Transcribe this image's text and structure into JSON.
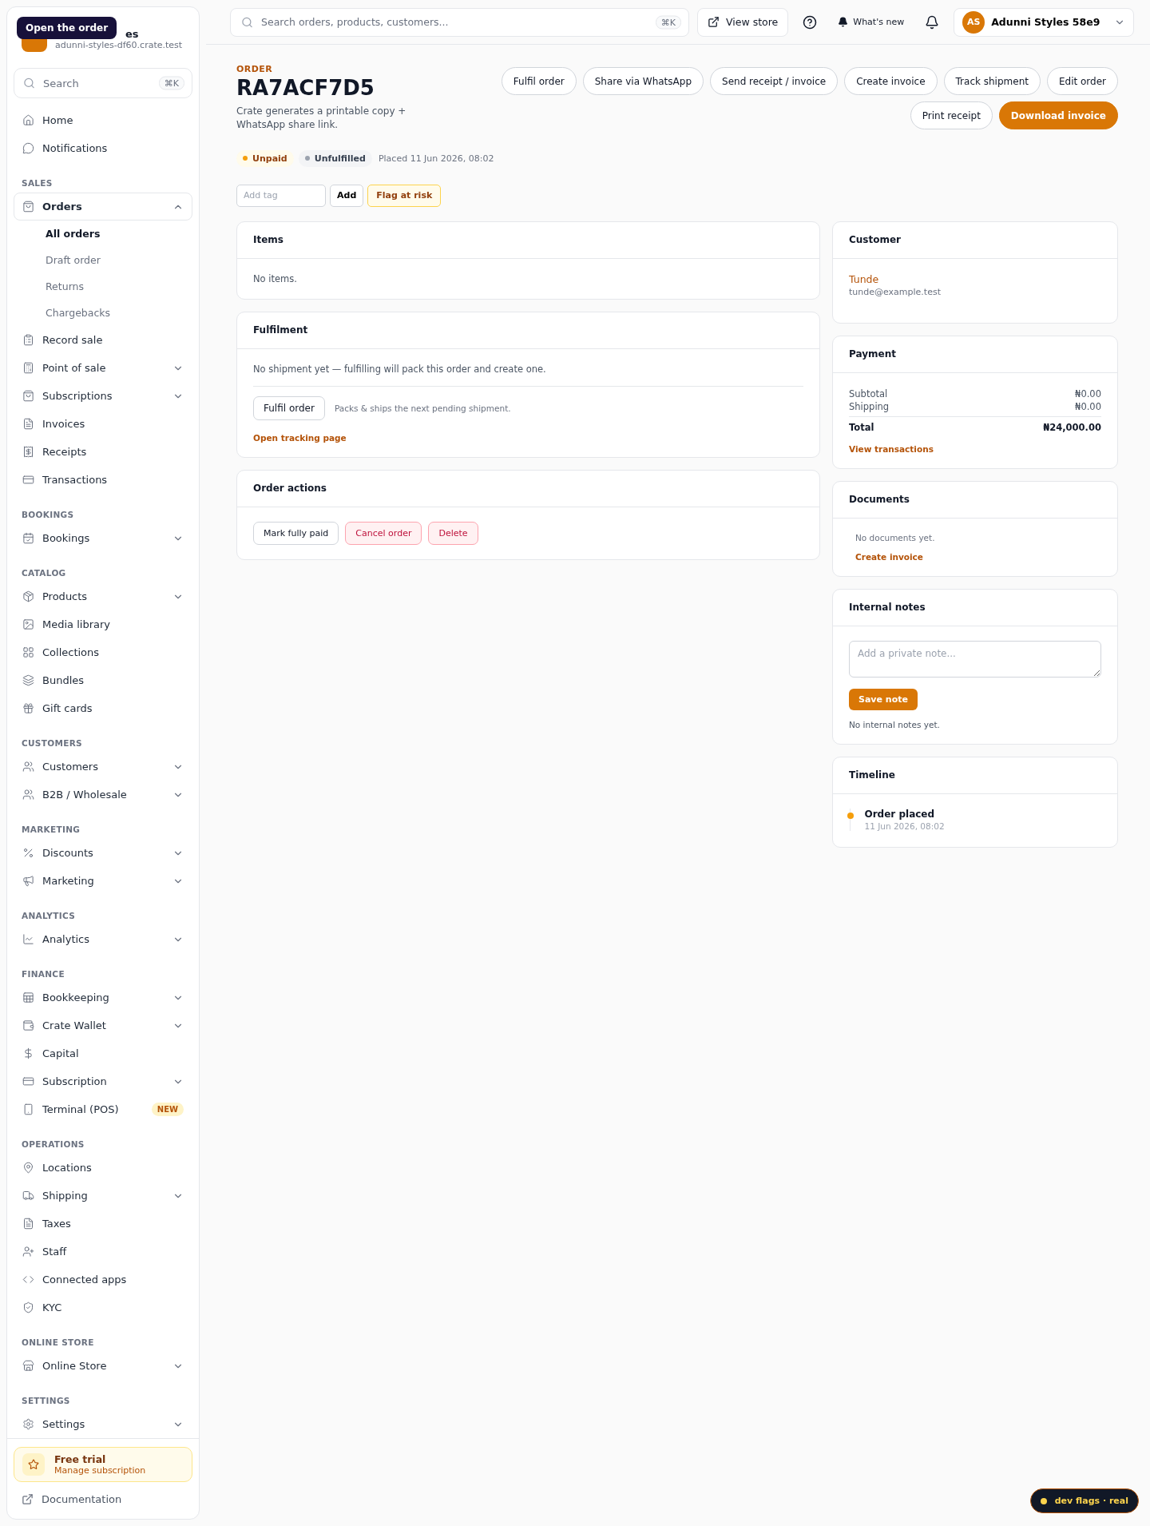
{
  "tooltip": "Open the order",
  "store": {
    "name": "es",
    "domain": "adunni-styles-df60.crate.test"
  },
  "sidebar_search": {
    "placeholder": "Search",
    "shortcut": "⌘K"
  },
  "sidebar": [
    {
      "items": [
        {
          "label": "Home",
          "kind": "link",
          "selected": false
        },
        {
          "label": "Notifications",
          "kind": "link",
          "selected": false
        }
      ]
    },
    {
      "title": "SALES",
      "items": [
        {
          "label": "Orders",
          "kind": "group",
          "expanded": true,
          "selected": true,
          "children": [
            {
              "label": "All orders",
              "selected": true
            },
            {
              "label": "Draft order",
              "selected": false
            },
            {
              "label": "Returns",
              "selected": false
            },
            {
              "label": "Chargebacks",
              "selected": false
            }
          ]
        },
        {
          "label": "Record sale",
          "kind": "link",
          "selected": false
        },
        {
          "label": "Point of sale",
          "kind": "group",
          "expanded": false,
          "selected": false
        },
        {
          "label": "Subscriptions",
          "kind": "group",
          "expanded": false,
          "selected": false
        },
        {
          "label": "Invoices",
          "kind": "link",
          "selected": false
        },
        {
          "label": "Receipts",
          "kind": "link",
          "selected": false
        },
        {
          "label": "Transactions",
          "kind": "link",
          "selected": false
        }
      ]
    },
    {
      "title": "BOOKINGS",
      "items": [
        {
          "label": "Bookings",
          "kind": "group",
          "expanded": false,
          "selected": false
        }
      ]
    },
    {
      "title": "CATALOG",
      "items": [
        {
          "label": "Products",
          "kind": "group",
          "expanded": false,
          "selected": false
        },
        {
          "label": "Media library",
          "kind": "link",
          "selected": false
        },
        {
          "label": "Collections",
          "kind": "link",
          "selected": false
        },
        {
          "label": "Bundles",
          "kind": "link",
          "selected": false
        },
        {
          "label": "Gift cards",
          "kind": "link",
          "selected": false
        }
      ]
    },
    {
      "title": "CUSTOMERS",
      "items": [
        {
          "label": "Customers",
          "kind": "group",
          "expanded": false,
          "selected": false
        },
        {
          "label": "B2B / Wholesale",
          "kind": "group",
          "expanded": false,
          "selected": false
        }
      ]
    },
    {
      "title": "MARKETING",
      "items": [
        {
          "label": "Discounts",
          "kind": "group",
          "expanded": false,
          "selected": false
        },
        {
          "label": "Marketing",
          "kind": "group",
          "expanded": false,
          "selected": false
        }
      ]
    },
    {
      "title": "ANALYTICS",
      "items": [
        {
          "label": "Analytics",
          "kind": "group",
          "expanded": false,
          "selected": false
        }
      ]
    },
    {
      "title": "FINANCE",
      "items": [
        {
          "label": "Bookkeeping",
          "kind": "group",
          "expanded": false,
          "selected": false
        },
        {
          "label": "Crate Wallet",
          "kind": "group",
          "expanded": false,
          "selected": false
        },
        {
          "label": "Capital",
          "kind": "link",
          "selected": false
        },
        {
          "label": "Subscription",
          "kind": "group",
          "expanded": false,
          "selected": false
        },
        {
          "label": "Terminal (POS)",
          "kind": "link",
          "selected": false,
          "badge": "NEW"
        }
      ]
    },
    {
      "title": "OPERATIONS",
      "items": [
        {
          "label": "Locations",
          "kind": "link",
          "selected": false
        },
        {
          "label": "Shipping",
          "kind": "group",
          "expanded": false,
          "selected": false
        },
        {
          "label": "Taxes",
          "kind": "link",
          "selected": false
        },
        {
          "label": "Staff",
          "kind": "link",
          "selected": false
        },
        {
          "label": "Connected apps",
          "kind": "link",
          "selected": false
        },
        {
          "label": "KYC",
          "kind": "link",
          "selected": false
        }
      ]
    },
    {
      "title": "ONLINE STORE",
      "items": [
        {
          "label": "Online Store",
          "kind": "group",
          "expanded": false,
          "selected": false
        }
      ]
    },
    {
      "title": "SETTINGS",
      "items": [
        {
          "label": "Settings",
          "kind": "group",
          "expanded": false,
          "selected": false
        }
      ]
    }
  ],
  "trial": {
    "title": "Free trial",
    "link": "Manage subscription"
  },
  "documentation": "Documentation",
  "topbar": {
    "search": {
      "placeholder": "Search orders, products, customers...",
      "shortcut": "⌘K"
    },
    "view_store": "View store",
    "whats_new": "What's new",
    "account": {
      "initials": "AS",
      "name": "Adunni Styles 58e9"
    }
  },
  "order": {
    "eyebrow": "ORDER",
    "id": "RA7ACF7D5",
    "description": "Crate generates a printable copy + WhatsApp share link.",
    "actions": [
      [
        {
          "label": "Fulfil order",
          "primary": false
        },
        {
          "label": "Share via WhatsApp",
          "primary": false
        },
        {
          "label": "Send receipt / invoice",
          "primary": false
        },
        {
          "label": "Create invoice",
          "primary": false
        },
        {
          "label": "Track shipment",
          "primary": false
        },
        {
          "label": "Edit order",
          "primary": false
        }
      ],
      [
        {
          "label": "Print receipt",
          "primary": false
        },
        {
          "label": "Download invoice",
          "primary": true
        }
      ]
    ],
    "statuses": [
      {
        "label": "Unpaid",
        "color": "#f59e0b"
      },
      {
        "label": "Unfulfilled",
        "color": "#9ca3af"
      }
    ],
    "placed": "Placed 11 Jun 2026, 08:02",
    "tag_input": {
      "placeholder": "Add tag"
    },
    "add_tag": "Add",
    "flag": "Flag at risk"
  },
  "items_card": {
    "title": "Items",
    "empty": "No items."
  },
  "fulfilment": {
    "title": "Fulfilment",
    "message": "No shipment yet — fulfilling will pack this order and create one.",
    "button": "Fulfil order",
    "hint": "Packs & ships the next pending shipment.",
    "link": "Open tracking page"
  },
  "order_actions": {
    "title": "Order actions",
    "buttons": [
      {
        "label": "Mark fully paid",
        "kind": "neutral"
      },
      {
        "label": "Cancel order",
        "kind": "danger"
      },
      {
        "label": "Delete",
        "kind": "danger"
      }
    ]
  },
  "customer": {
    "title": "Customer",
    "name": "Tunde",
    "email": "tunde@example.test"
  },
  "payment": {
    "title": "Payment",
    "rows": [
      {
        "label": "Subtotal",
        "value": "₦0.00",
        "kind": "line"
      },
      {
        "label": "Shipping",
        "value": "₦0.00",
        "kind": "line"
      },
      {
        "label": "Total",
        "value": "₦24,000.00",
        "kind": "total"
      }
    ],
    "link": "View transactions"
  },
  "documents": {
    "title": "Documents",
    "empty": "No documents yet.",
    "link": "Create invoice"
  },
  "notes": {
    "title": "Internal notes",
    "placeholder": "Add a private note...",
    "button": "Save note",
    "empty": "No internal notes yet."
  },
  "timeline": {
    "title": "Timeline",
    "events": [
      {
        "title": "Order placed",
        "time": "11 Jun 2026, 08:02",
        "color": "#f59e0b"
      }
    ]
  },
  "dev_flags": "dev flags · real"
}
